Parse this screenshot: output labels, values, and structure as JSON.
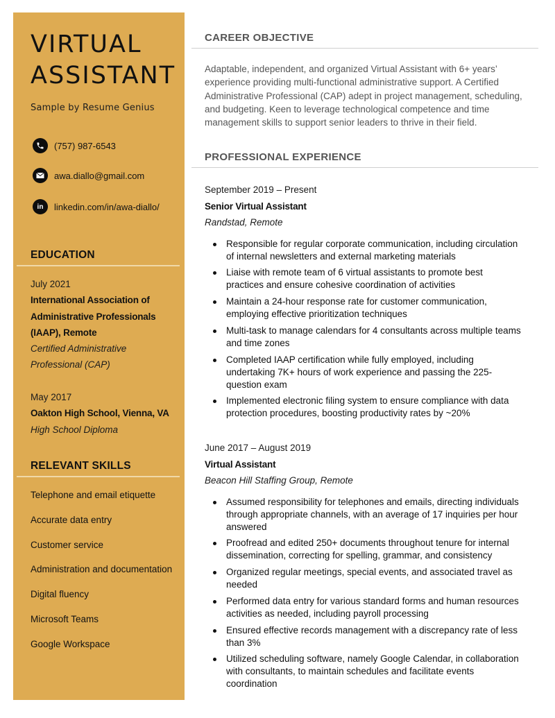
{
  "header": {
    "name_line1": "VIRTUAL",
    "name_line2": "ASSISTANT",
    "subtitle": "Sample by Resume Genius"
  },
  "contact": {
    "phone": {
      "icon": "phone-icon",
      "text": "(757) 987-6543"
    },
    "email": {
      "icon": "envelope-icon",
      "text": "awa.diallo@gmail.com"
    },
    "linkedin": {
      "icon": "linkedin-icon",
      "icon_text": "in",
      "text": "linkedin.com/in/awa-diallo/"
    }
  },
  "education": {
    "heading": "EDUCATION",
    "items": [
      {
        "date": "July 2021",
        "institution": "International Association of Administrative Professionals (IAAP), Remote",
        "degree": "Certified Administrative Professional (CAP)"
      },
      {
        "date": "May 2017",
        "institution": "Oakton High School, Vienna, VA",
        "degree": "High School Diploma"
      }
    ]
  },
  "skills": {
    "heading": "RELEVANT SKILLS",
    "items": [
      "Telephone and email etiquette",
      "Accurate data entry",
      "Customer service",
      "Administration and documentation",
      "Digital fluency",
      "Microsoft Teams",
      "Google Workspace"
    ]
  },
  "objective": {
    "heading": "CAREER OBJECTIVE",
    "text": "Adaptable, independent, and organized Virtual Assistant with 6+ years’ experience providing multi-functional administrative support. A Certified Administrative Professional (CAP) adept in project management, scheduling, and budgeting. Keen to leverage technological competence and time management skills to support senior leaders to thrive in their field."
  },
  "experience": {
    "heading": "PROFESSIONAL EXPERIENCE",
    "jobs": [
      {
        "dates": "September 2019 – Present",
        "title": "Senior Virtual Assistant",
        "company": "Randstad, Remote",
        "bullets": [
          "Responsible for regular corporate communication, including circulation of internal newsletters and external marketing materials",
          "Liaise with remote team of 6 virtual assistants to promote best practices and ensure cohesive coordination of activities",
          "Maintain a 24-hour response rate for customer communication, employing effective prioritization techniques",
          "Multi-task to manage calendars for 4 consultants across multiple teams and time zones",
          "Completed IAAP certification while fully employed, including undertaking 7K+ hours of work experience and passing the 225-question exam",
          "Implemented electronic filing system to ensure compliance with data protection procedures, boosting productivity rates by ~20%"
        ]
      },
      {
        "dates": "June 2017 – August 2019",
        "title": "Virtual Assistant",
        "company": "Beacon Hill Staffing Group, Remote",
        "bullets": [
          "Assumed responsibility for telephones and emails, directing individuals through appropriate channels, with an average of 17 inquiries per hour answered",
          "Proofread and edited 250+ documents throughout tenure for internal dissemination, correcting for spelling, grammar, and consistency",
          "Organized regular meetings, special events, and associated travel as needed",
          "Performed data entry for various standard forms and human resources activities as needed, including payroll processing",
          "Ensured effective records management with a discrepancy rate of less than 3%",
          "Utilized scheduling software, namely Google Calendar, in collaboration with consultants, to maintain schedules and facilitate events coordination"
        ]
      }
    ]
  },
  "colors": {
    "sidebar_accent": "#DEAB52",
    "heading_gray": "#555555",
    "text_dark": "#111111"
  }
}
